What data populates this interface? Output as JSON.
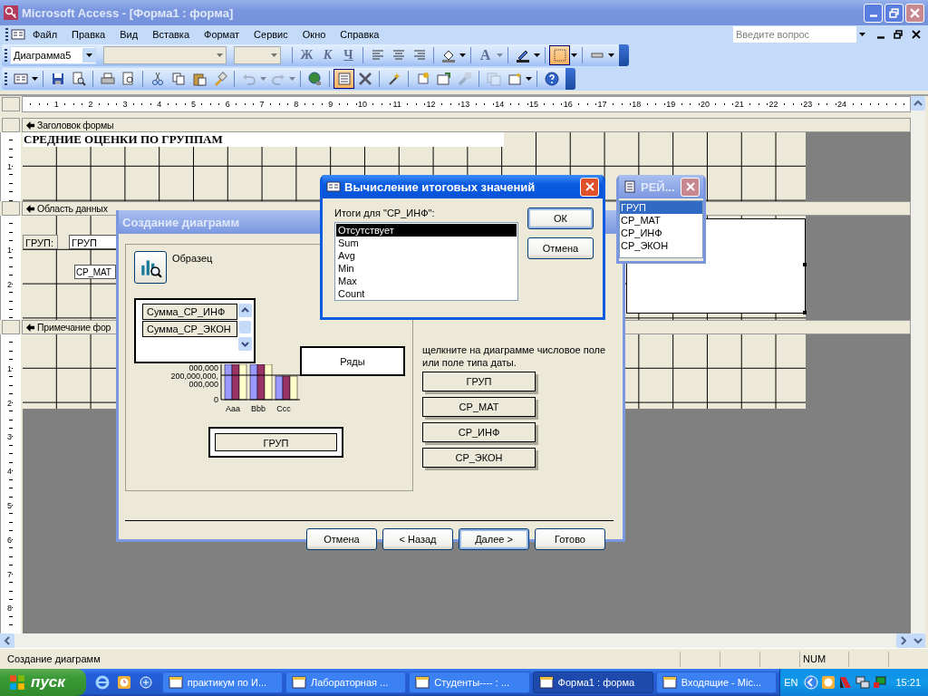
{
  "window": {
    "title": "Microsoft Access - [Форма1 : форма]"
  },
  "menu": [
    {
      "label": "Файл"
    },
    {
      "label": "Правка"
    },
    {
      "label": "Вид"
    },
    {
      "label": "Вставка"
    },
    {
      "label": "Формат"
    },
    {
      "label": "Сервис"
    },
    {
      "label": "Окно"
    },
    {
      "label": "Справка"
    }
  ],
  "help_search": {
    "placeholder": "Введите вопрос"
  },
  "formatting_toolbar": {
    "object_combo": "Диаграмма5",
    "style_buttons": [
      {
        "label": "Ж",
        "disabled": true
      },
      {
        "label": "К",
        "disabled": true
      },
      {
        "label": "Ч",
        "disabled": true
      }
    ],
    "font_color": {
      "label": "A",
      "disabled": true
    },
    "icon_buttons": [
      {
        "pressed": false
      },
      {
        "pressed": false
      },
      {
        "pressed": false
      },
      {
        "pressed": false
      },
      {
        "pressed": false
      },
      {
        "pressed": true
      },
      {
        "pressed": false
      }
    ]
  },
  "standard_toolbar": {
    "icon_buttons": [
      {
        "pressed": false,
        "disabled": false
      },
      {
        "pressed": false,
        "disabled": false
      },
      {
        "pressed": false,
        "disabled": false
      },
      {
        "pressed": false,
        "disabled": false
      },
      {
        "pressed": false,
        "disabled": false
      },
      {
        "pressed": false,
        "disabled": false
      },
      {
        "pressed": false,
        "disabled": false
      },
      {
        "pressed": false,
        "disabled": false
      },
      {
        "pressed": false,
        "disabled": false
      },
      {
        "pressed": false,
        "disabled": true
      },
      {
        "pressed": false,
        "disabled": true
      },
      {
        "pressed": false,
        "disabled": false
      },
      {
        "pressed": true,
        "disabled": false
      },
      {
        "pressed": false,
        "disabled": false
      },
      {
        "pressed": false,
        "disabled": false
      },
      {
        "pressed": false,
        "disabled": false
      },
      {
        "pressed": false,
        "disabled": false
      },
      {
        "pressed": false,
        "disabled": true
      },
      {
        "pressed": false,
        "disabled": true
      },
      {
        "pressed": false,
        "disabled": false
      },
      {
        "pressed": false,
        "disabled": false
      }
    ]
  },
  "ruler": [
    "1",
    "2",
    "3",
    "4",
    "5",
    "6",
    "7",
    "8",
    "9",
    "10",
    "11",
    "12",
    "13",
    "14",
    "15",
    "16",
    "17",
    "18",
    "19",
    "20",
    "21",
    "22",
    "23",
    "24"
  ],
  "form": {
    "sections": [
      {
        "kind": "header",
        "title": "Заголовок формы",
        "ruler": [
          "1"
        ],
        "caption": "СРЕДНИЕ ОЦЕНКИ ПО ГРУППАМ"
      },
      {
        "kind": "detail",
        "title": "Область данных",
        "ruler": [
          "1",
          "2"
        ],
        "controls": [
          {
            "kind": "label",
            "text": "ГРУП:"
          },
          {
            "kind": "field",
            "text": "ГРУП"
          },
          {
            "kind": "field",
            "text": "СР_МАТ"
          },
          {
            "kind": "chart"
          }
        ]
      },
      {
        "kind": "footer",
        "title": "Примечание фор",
        "ruler": [
          "1",
          "2",
          "3",
          "4",
          "5",
          "6",
          "7",
          "8"
        ]
      }
    ]
  },
  "chart_wizard": {
    "title": "Создание диаграмм",
    "sample_label": "Образец",
    "series_list": [
      "Сумма_СР_ИНФ",
      "Сумма_СР_ЭКОН"
    ],
    "y_labels": [
      "000,000",
      "200,000,000,",
      "000,000",
      "0"
    ],
    "x_labels": [
      "Aaa",
      "Bbb",
      "Ccc"
    ],
    "series_drop": "Ряды",
    "axis_drop": "ГРУП",
    "hint": "щелкните на диаграмме числовое поле или поле типа даты.",
    "fields": [
      "ГРУП",
      "СР_МАТ",
      "СР_ИНФ",
      "СР_ЭКОН"
    ],
    "buttons": [
      {
        "label": "Отмена",
        "default": false
      },
      {
        "label": "< Назад",
        "default": false
      },
      {
        "label": "Далее >",
        "default": true
      },
      {
        "label": "Готово",
        "default": false
      }
    ]
  },
  "summary_dialog": {
    "title": "Вычисление итоговых значений",
    "label": "Итоги для \"СР_ИНФ\":",
    "options": [
      {
        "label": "Отсутствует",
        "selected": true
      },
      {
        "label": "Sum",
        "selected": false
      },
      {
        "label": "Avg",
        "selected": false
      },
      {
        "label": "Min",
        "selected": false
      },
      {
        "label": "Max",
        "selected": false
      },
      {
        "label": "Count",
        "selected": false
      }
    ],
    "buttons": [
      "ОК",
      "Отмена"
    ]
  },
  "field_list": {
    "title": "РЕЙ...",
    "items": [
      {
        "label": "ГРУП",
        "selected": true
      },
      {
        "label": "СР_МАТ",
        "selected": false
      },
      {
        "label": "СР_ИНФ",
        "selected": false
      },
      {
        "label": "СР_ЭКОН",
        "selected": false
      }
    ]
  },
  "status_bar": {
    "text": "Создание диаграмм",
    "indicator": "NUM"
  },
  "taskbar": {
    "start": "пуск",
    "tasks": [
      {
        "label": "практикум по И...",
        "selected": false
      },
      {
        "label": "Лабораторная ...",
        "selected": false
      },
      {
        "label": "Студенты---- : ...",
        "selected": false
      },
      {
        "label": "Форма1 : форма",
        "selected": true
      },
      {
        "label": "Входящие - Mic...",
        "selected": false
      }
    ],
    "language": "EN",
    "time": "15:21"
  }
}
